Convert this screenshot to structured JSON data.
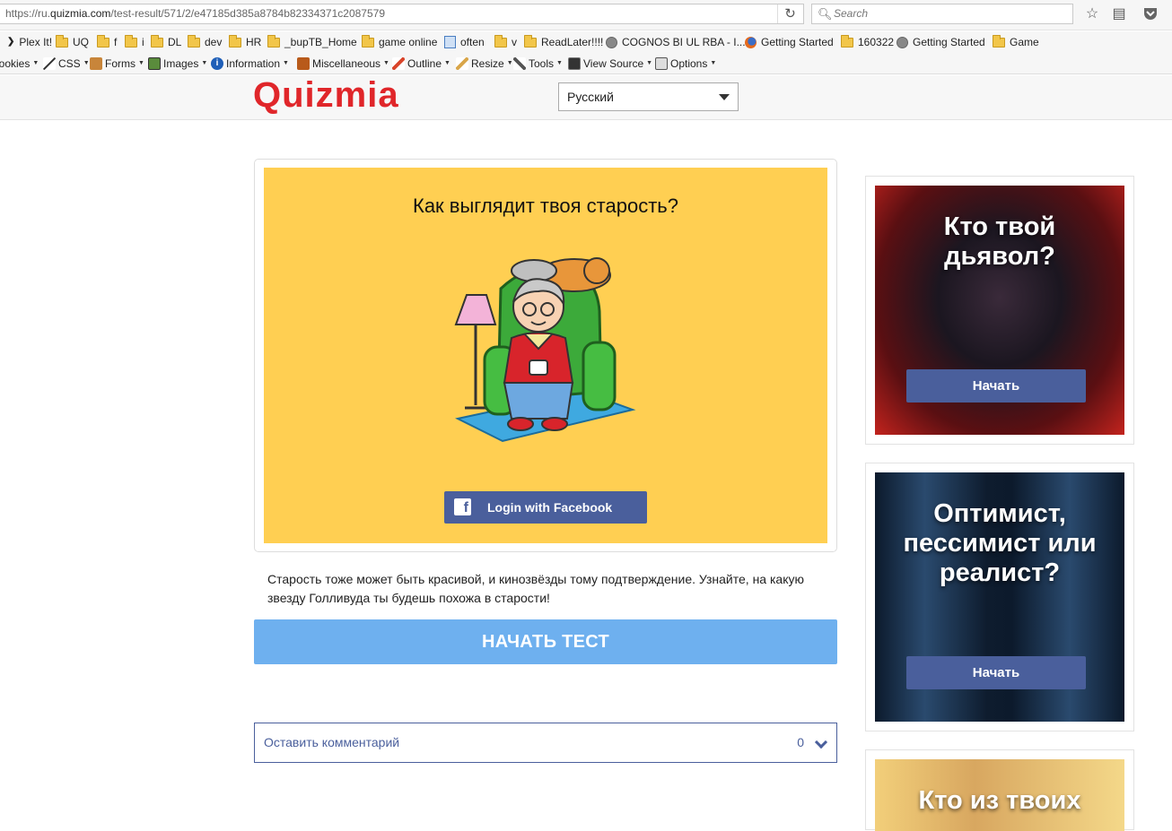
{
  "browser": {
    "url_prefix": "https://ru.",
    "url_domain": "quizmia.com",
    "url_path": "/test-result/571/2/e47185d385a8784b82334371c2087579",
    "search_placeholder": "Search",
    "bookmarks": [
      {
        "label": "Plex It!",
        "icon": "chevron-icon"
      },
      {
        "label": "UQ",
        "icon": "folder-icon"
      },
      {
        "label": "f",
        "icon": "folder-icon"
      },
      {
        "label": "i",
        "icon": "folder-icon"
      },
      {
        "label": "DL",
        "icon": "folder-icon"
      },
      {
        "label": "dev",
        "icon": "folder-icon"
      },
      {
        "label": "HR",
        "icon": "folder-icon"
      },
      {
        "label": "_bupTB_Home",
        "icon": "folder-icon"
      },
      {
        "label": "game online",
        "icon": "folder-icon"
      },
      {
        "label": "often",
        "icon": "page-icon"
      },
      {
        "label": "v",
        "icon": "folder-icon"
      },
      {
        "label": "ReadLater!!!!",
        "icon": "folder-icon"
      },
      {
        "label": "COGNOS BI UL RBA - I...",
        "icon": "globe-icon"
      },
      {
        "label": "Getting Started",
        "icon": "firefox-icon"
      },
      {
        "label": "160322",
        "icon": "folder-icon"
      },
      {
        "label": "Getting Started",
        "icon": "globe-icon"
      },
      {
        "label": "Game",
        "icon": "folder-icon"
      }
    ],
    "webdev_menus": [
      "Cookies",
      "CSS",
      "Forms",
      "Images",
      "Information",
      "Miscellaneous",
      "Outline",
      "Resize",
      "Tools",
      "View Source",
      "Options"
    ]
  },
  "site": {
    "logo": "Quizmia",
    "language": "Русский"
  },
  "quiz": {
    "title": "Как выглядит твоя старость?",
    "facebook_login": "Login with Facebook",
    "description": "Старость тоже может быть красивой, и кинозвёзды тому подтверждение. Узнайте, на какую звезду Голливуда ты будешь похожа в старости!",
    "start_button": "НАЧАТЬ ТЕСТ"
  },
  "comments": {
    "label": "Оставить комментарий",
    "count": "0"
  },
  "sidebar": [
    {
      "title": "Кто твой дьявол?",
      "button": "Начать"
    },
    {
      "title": "Оптимист, пессимист или реалист?",
      "button": "Начать"
    },
    {
      "title": "Кто из твоих",
      "button": ""
    }
  ],
  "colors": {
    "brand_red": "#e0262a",
    "quiz_bg": "#ffcf52",
    "facebook_blue": "#4a5f9c",
    "start_blue": "#6eb0ef"
  }
}
